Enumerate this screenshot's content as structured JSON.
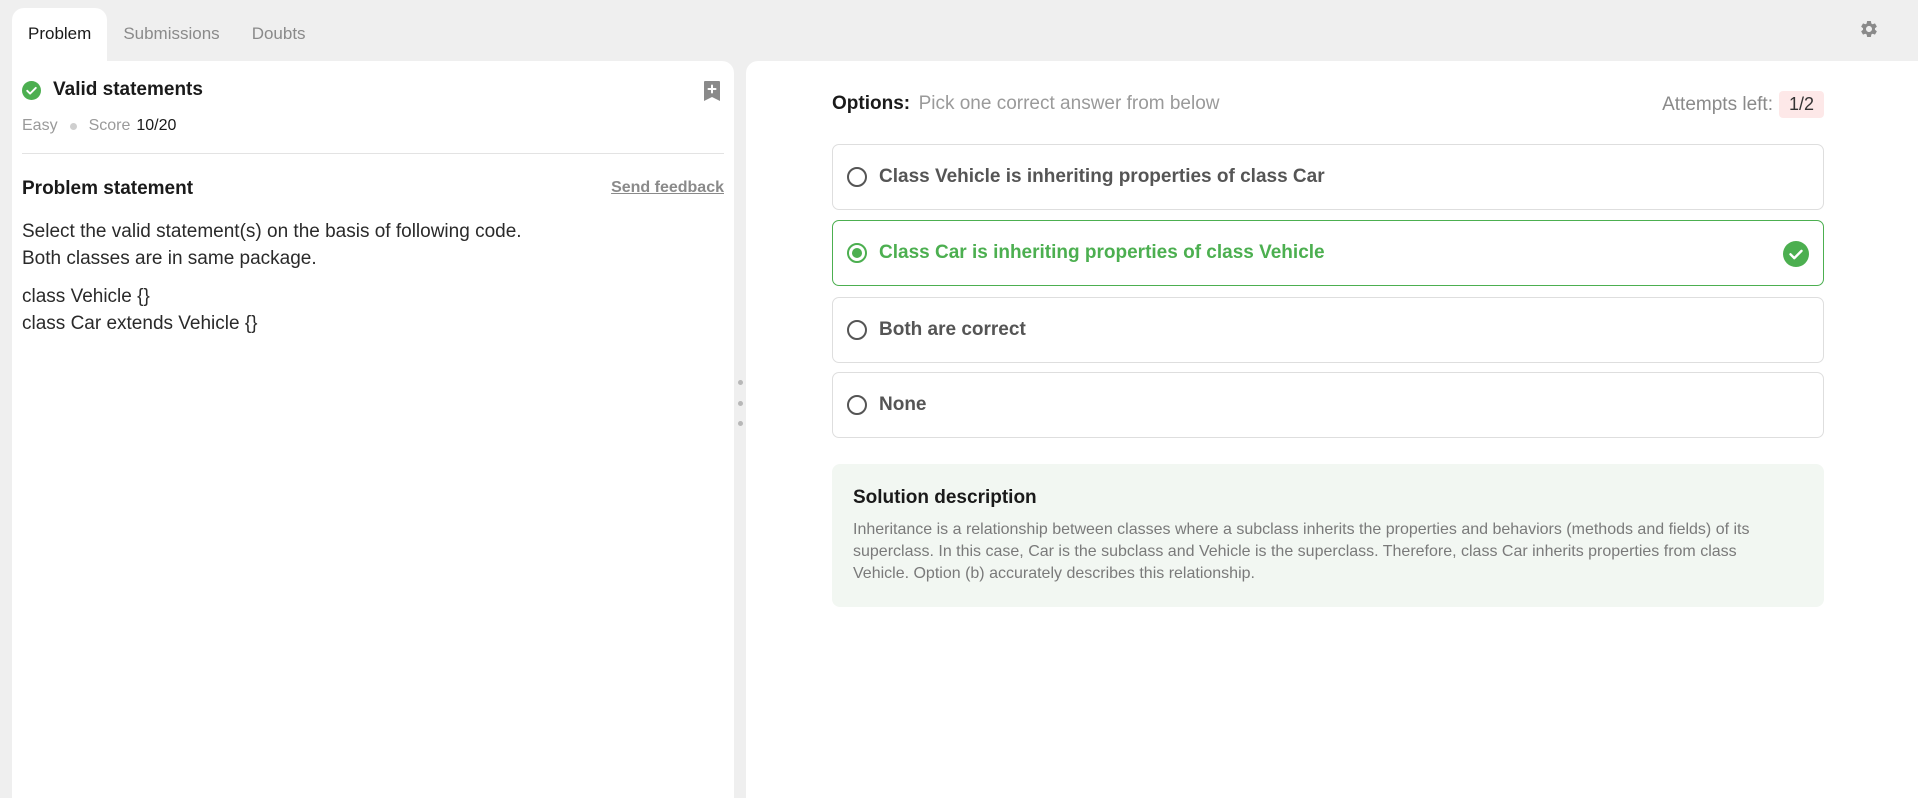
{
  "tabs": [
    {
      "label": "Problem",
      "active": true
    },
    {
      "label": "Submissions",
      "active": false
    },
    {
      "label": "Doubts",
      "active": false
    }
  ],
  "icons": {
    "settings": "gear-icon",
    "status": "check-circle-icon",
    "bookmark": "bookmark-add-icon",
    "correct": "check-circle-icon"
  },
  "colors": {
    "success": "#4caf50",
    "attempts_bg": "#fde8e8",
    "solution_bg": "#f2f7f2"
  },
  "problem": {
    "title": "Valid statements",
    "difficulty": "Easy",
    "score_label": "Score",
    "score_value": "10/20",
    "statement_title": "Problem statement",
    "feedback_label": "Send feedback",
    "statement_lines": [
      "Select the valid statement(s) on the basis of following code.",
      "Both classes are in same package."
    ],
    "code_lines": [
      "class Vehicle {}",
      "class Car extends Vehicle {}"
    ]
  },
  "options_panel": {
    "label": "Options:",
    "hint": "Pick one correct answer from below",
    "attempts_label": "Attempts left:",
    "attempts_value": "1/2",
    "options": [
      {
        "text": "Class Vehicle is inheriting properties of class Car",
        "selected": false
      },
      {
        "text": "Class Car is inheriting properties of class Vehicle",
        "selected": true,
        "correct": true
      },
      {
        "text": "Both are correct",
        "selected": false
      },
      {
        "text": "None",
        "selected": false
      }
    ]
  },
  "solution": {
    "title": "Solution description",
    "lines": [
      "Inheritance is a relationship between classes where a subclass inherits the properties and behaviors (methods and fields) of its",
      "superclass. In this case, Car is the subclass and Vehicle is the superclass. Therefore, class Car inherits properties from class",
      "Vehicle. Option (b) accurately describes this relationship."
    ]
  }
}
